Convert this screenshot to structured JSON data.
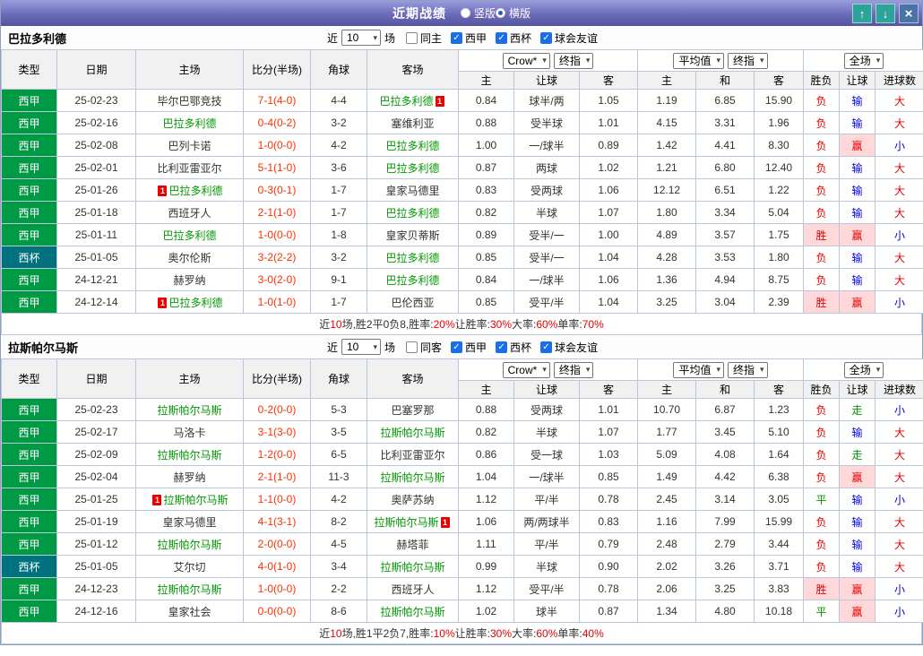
{
  "topbar": {
    "title": "近期战绩",
    "view_options": [
      {
        "label": "竖版",
        "selected": false
      },
      {
        "label": "横版",
        "selected": true
      }
    ],
    "buttons": {
      "up": "↑",
      "down": "↓",
      "close": "×"
    }
  },
  "table_header": {
    "main_cols": [
      "类型",
      "日期",
      "主场",
      "比分(半场)",
      "角球",
      "客场"
    ],
    "select_groups": [
      [
        "Crow*",
        "终指"
      ],
      [
        "平均值",
        "终指"
      ],
      [
        "全场"
      ]
    ],
    "sub_cols": [
      "主",
      "让球",
      "客",
      "主",
      "和",
      "客",
      "胜负",
      "让球",
      "进球数"
    ]
  },
  "sections": [
    {
      "team": "巴拉多利德",
      "filter": {
        "prefix": "近",
        "count": "10",
        "suffix": "场",
        "checkboxes": [
          {
            "label": "同主",
            "checked": false
          },
          {
            "label": "西甲",
            "checked": true
          },
          {
            "label": "西杯",
            "checked": true
          },
          {
            "label": "球会友谊",
            "checked": true
          }
        ]
      },
      "rows": [
        {
          "league": "西甲",
          "lg": "liga",
          "date": "25-02-23",
          "home": {
            "name": "毕尔巴鄂竞技"
          },
          "score": "7-1(4-0)",
          "corners": "4-4",
          "away": {
            "name": "巴拉多利德",
            "tracked": true,
            "red": "1",
            "red_pos": "after"
          },
          "odds": [
            "0.84",
            "球半/两",
            "1.05"
          ],
          "avg": [
            "1.19",
            "6.85",
            "15.90"
          ],
          "res": [
            {
              "t": "负",
              "c": "r"
            },
            {
              "t": "输",
              "c": "b"
            },
            {
              "t": "大",
              "c": "r"
            }
          ]
        },
        {
          "league": "西甲",
          "lg": "liga",
          "date": "25-02-16",
          "home": {
            "name": "巴拉多利德",
            "tracked": true
          },
          "score": "0-4(0-2)",
          "corners": "3-2",
          "away": {
            "name": "塞维利亚"
          },
          "odds": [
            "0.88",
            "受半球",
            "1.01"
          ],
          "avg": [
            "4.15",
            "3.31",
            "1.96"
          ],
          "res": [
            {
              "t": "负",
              "c": "r"
            },
            {
              "t": "输",
              "c": "b"
            },
            {
              "t": "大",
              "c": "r"
            }
          ]
        },
        {
          "league": "西甲",
          "lg": "liga",
          "date": "25-02-08",
          "home": {
            "name": "巴列卡诺"
          },
          "score": "1-0(0-0)",
          "corners": "4-2",
          "away": {
            "name": "巴拉多利德",
            "tracked": true
          },
          "odds": [
            "1.00",
            "一/球半",
            "0.89"
          ],
          "avg": [
            "1.42",
            "4.41",
            "8.30"
          ],
          "res": [
            {
              "t": "负",
              "c": "r"
            },
            {
              "t": "赢",
              "c": "rbg"
            },
            {
              "t": "小",
              "c": "b"
            }
          ]
        },
        {
          "league": "西甲",
          "lg": "liga",
          "date": "25-02-01",
          "home": {
            "name": "比利亚雷亚尔"
          },
          "score": "5-1(1-0)",
          "corners": "3-6",
          "away": {
            "name": "巴拉多利德",
            "tracked": true
          },
          "odds": [
            "0.87",
            "两球",
            "1.02"
          ],
          "avg": [
            "1.21",
            "6.80",
            "12.40"
          ],
          "res": [
            {
              "t": "负",
              "c": "r"
            },
            {
              "t": "输",
              "c": "b"
            },
            {
              "t": "大",
              "c": "r"
            }
          ]
        },
        {
          "league": "西甲",
          "lg": "liga",
          "date": "25-01-26",
          "home": {
            "name": "巴拉多利德",
            "tracked": true,
            "red": "1",
            "red_pos": "before"
          },
          "score": "0-3(0-1)",
          "corners": "1-7",
          "away": {
            "name": "皇家马德里"
          },
          "odds": [
            "0.83",
            "受两球",
            "1.06"
          ],
          "avg": [
            "12.12",
            "6.51",
            "1.22"
          ],
          "res": [
            {
              "t": "负",
              "c": "r"
            },
            {
              "t": "输",
              "c": "b"
            },
            {
              "t": "大",
              "c": "r"
            }
          ]
        },
        {
          "league": "西甲",
          "lg": "liga",
          "date": "25-01-18",
          "home": {
            "name": "西班牙人"
          },
          "score": "2-1(1-0)",
          "corners": "1-7",
          "away": {
            "name": "巴拉多利德",
            "tracked": true
          },
          "odds": [
            "0.82",
            "半球",
            "1.07"
          ],
          "avg": [
            "1.80",
            "3.34",
            "5.04"
          ],
          "res": [
            {
              "t": "负",
              "c": "r"
            },
            {
              "t": "输",
              "c": "b"
            },
            {
              "t": "大",
              "c": "r"
            }
          ]
        },
        {
          "league": "西甲",
          "lg": "liga",
          "date": "25-01-11",
          "home": {
            "name": "巴拉多利德",
            "tracked": true
          },
          "score": "1-0(0-0)",
          "corners": "1-8",
          "away": {
            "name": "皇家贝蒂斯"
          },
          "odds": [
            "0.89",
            "受半/一",
            "1.00"
          ],
          "avg": [
            "4.89",
            "3.57",
            "1.75"
          ],
          "res": [
            {
              "t": "胜",
              "c": "rbg"
            },
            {
              "t": "赢",
              "c": "rbg"
            },
            {
              "t": "小",
              "c": "b"
            }
          ]
        },
        {
          "league": "西杯",
          "lg": "cup",
          "date": "25-01-05",
          "home": {
            "name": "奥尔伦斯"
          },
          "score": "3-2(2-2)",
          "corners": "3-2",
          "away": {
            "name": "巴拉多利德",
            "tracked": true
          },
          "odds": [
            "0.85",
            "受半/一",
            "1.04"
          ],
          "avg": [
            "4.28",
            "3.53",
            "1.80"
          ],
          "res": [
            {
              "t": "负",
              "c": "r"
            },
            {
              "t": "输",
              "c": "b"
            },
            {
              "t": "大",
              "c": "r"
            }
          ]
        },
        {
          "league": "西甲",
          "lg": "liga",
          "date": "24-12-21",
          "home": {
            "name": "赫罗纳"
          },
          "score": "3-0(2-0)",
          "corners": "9-1",
          "away": {
            "name": "巴拉多利德",
            "tracked": true
          },
          "odds": [
            "0.84",
            "一/球半",
            "1.06"
          ],
          "avg": [
            "1.36",
            "4.94",
            "8.75"
          ],
          "res": [
            {
              "t": "负",
              "c": "r"
            },
            {
              "t": "输",
              "c": "b"
            },
            {
              "t": "大",
              "c": "r"
            }
          ]
        },
        {
          "league": "西甲",
          "lg": "liga",
          "date": "24-12-14",
          "home": {
            "name": "巴拉多利德",
            "tracked": true,
            "red": "1",
            "red_pos": "before"
          },
          "score": "1-0(1-0)",
          "corners": "1-7",
          "away": {
            "name": "巴伦西亚"
          },
          "odds": [
            "0.85",
            "受平/半",
            "1.04"
          ],
          "avg": [
            "3.25",
            "3.04",
            "2.39"
          ],
          "res": [
            {
              "t": "胜",
              "c": "rbg"
            },
            {
              "t": "赢",
              "c": "rbg"
            },
            {
              "t": "小",
              "c": "b"
            }
          ]
        }
      ],
      "summary_parts": [
        {
          "t": "近",
          "c": "k"
        },
        {
          "t": "10",
          "c": "r"
        },
        {
          "t": "场,胜2平0负8, ",
          "c": "k"
        },
        {
          "t": "胜率:",
          "c": "k"
        },
        {
          "t": "20%",
          "c": "r"
        },
        {
          "t": " 让胜率:",
          "c": "k"
        },
        {
          "t": "30%",
          "c": "r"
        },
        {
          "t": " 大率:",
          "c": "k"
        },
        {
          "t": "60%",
          "c": "r"
        },
        {
          "t": " 单率:",
          "c": "k"
        },
        {
          "t": "70%",
          "c": "r"
        }
      ]
    },
    {
      "team": "拉斯帕尔马斯",
      "filter": {
        "prefix": "近",
        "count": "10",
        "suffix": "场",
        "checkboxes": [
          {
            "label": "同客",
            "checked": false
          },
          {
            "label": "西甲",
            "checked": true
          },
          {
            "label": "西杯",
            "checked": true
          },
          {
            "label": "球会友谊",
            "checked": true
          }
        ]
      },
      "rows": [
        {
          "league": "西甲",
          "lg": "liga",
          "date": "25-02-23",
          "home": {
            "name": "拉斯帕尔马斯",
            "tracked": true
          },
          "score": "0-2(0-0)",
          "corners": "5-3",
          "away": {
            "name": "巴塞罗那"
          },
          "odds": [
            "0.88",
            "受两球",
            "1.01"
          ],
          "avg": [
            "10.70",
            "6.87",
            "1.23"
          ],
          "res": [
            {
              "t": "负",
              "c": "r"
            },
            {
              "t": "走",
              "c": "g"
            },
            {
              "t": "小",
              "c": "b"
            }
          ]
        },
        {
          "league": "西甲",
          "lg": "liga",
          "date": "25-02-17",
          "home": {
            "name": "马洛卡"
          },
          "score": "3-1(3-0)",
          "corners": "3-5",
          "away": {
            "name": "拉斯帕尔马斯",
            "tracked": true
          },
          "odds": [
            "0.82",
            "半球",
            "1.07"
          ],
          "avg": [
            "1.77",
            "3.45",
            "5.10"
          ],
          "res": [
            {
              "t": "负",
              "c": "r"
            },
            {
              "t": "输",
              "c": "b"
            },
            {
              "t": "大",
              "c": "r"
            }
          ]
        },
        {
          "league": "西甲",
          "lg": "liga",
          "date": "25-02-09",
          "home": {
            "name": "拉斯帕尔马斯",
            "tracked": true
          },
          "score": "1-2(0-0)",
          "corners": "6-5",
          "away": {
            "name": "比利亚雷亚尔"
          },
          "odds": [
            "0.86",
            "受一球",
            "1.03"
          ],
          "avg": [
            "5.09",
            "4.08",
            "1.64"
          ],
          "res": [
            {
              "t": "负",
              "c": "r"
            },
            {
              "t": "走",
              "c": "g"
            },
            {
              "t": "大",
              "c": "r"
            }
          ]
        },
        {
          "league": "西甲",
          "lg": "liga",
          "date": "25-02-04",
          "home": {
            "name": "赫罗纳"
          },
          "score": "2-1(1-0)",
          "corners": "11-3",
          "away": {
            "name": "拉斯帕尔马斯",
            "tracked": true
          },
          "odds": [
            "1.04",
            "一/球半",
            "0.85"
          ],
          "avg": [
            "1.49",
            "4.42",
            "6.38"
          ],
          "res": [
            {
              "t": "负",
              "c": "r"
            },
            {
              "t": "赢",
              "c": "rbg"
            },
            {
              "t": "大",
              "c": "r"
            }
          ]
        },
        {
          "league": "西甲",
          "lg": "liga",
          "date": "25-01-25",
          "home": {
            "name": "拉斯帕尔马斯",
            "tracked": true,
            "red": "1",
            "red_pos": "before"
          },
          "score": "1-1(0-0)",
          "corners": "4-2",
          "away": {
            "name": "奥萨苏纳"
          },
          "odds": [
            "1.12",
            "平/半",
            "0.78"
          ],
          "avg": [
            "2.45",
            "3.14",
            "3.05"
          ],
          "res": [
            {
              "t": "平",
              "c": "g"
            },
            {
              "t": "输",
              "c": "b"
            },
            {
              "t": "小",
              "c": "b"
            }
          ]
        },
        {
          "league": "西甲",
          "lg": "liga",
          "date": "25-01-19",
          "home": {
            "name": "皇家马德里"
          },
          "score": "4-1(3-1)",
          "corners": "8-2",
          "away": {
            "name": "拉斯帕尔马斯",
            "tracked": true,
            "red": "1",
            "red_pos": "after"
          },
          "odds": [
            "1.06",
            "两/两球半",
            "0.83"
          ],
          "avg": [
            "1.16",
            "7.99",
            "15.99"
          ],
          "res": [
            {
              "t": "负",
              "c": "r"
            },
            {
              "t": "输",
              "c": "b"
            },
            {
              "t": "大",
              "c": "r"
            }
          ]
        },
        {
          "league": "西甲",
          "lg": "liga",
          "date": "25-01-12",
          "home": {
            "name": "拉斯帕尔马斯",
            "tracked": true
          },
          "score": "2-0(0-0)",
          "corners": "4-5",
          "away": {
            "name": "赫塔菲"
          },
          "odds": [
            "1.11",
            "平/半",
            "0.79"
          ],
          "avg": [
            "2.48",
            "2.79",
            "3.44"
          ],
          "res": [
            {
              "t": "负",
              "c": "r"
            },
            {
              "t": "输",
              "c": "b"
            },
            {
              "t": "大",
              "c": "r"
            }
          ]
        },
        {
          "league": "西杯",
          "lg": "cup",
          "date": "25-01-05",
          "home": {
            "name": "艾尔切"
          },
          "score": "4-0(1-0)",
          "corners": "3-4",
          "away": {
            "name": "拉斯帕尔马斯",
            "tracked": true
          },
          "odds": [
            "0.99",
            "半球",
            "0.90"
          ],
          "avg": [
            "2.02",
            "3.26",
            "3.71"
          ],
          "res": [
            {
              "t": "负",
              "c": "r"
            },
            {
              "t": "输",
              "c": "b"
            },
            {
              "t": "大",
              "c": "r"
            }
          ]
        },
        {
          "league": "西甲",
          "lg": "liga",
          "date": "24-12-23",
          "home": {
            "name": "拉斯帕尔马斯",
            "tracked": true
          },
          "score": "1-0(0-0)",
          "corners": "2-2",
          "away": {
            "name": "西班牙人"
          },
          "odds": [
            "1.12",
            "受平/半",
            "0.78"
          ],
          "avg": [
            "2.06",
            "3.25",
            "3.83"
          ],
          "res": [
            {
              "t": "胜",
              "c": "rbg"
            },
            {
              "t": "赢",
              "c": "rbg"
            },
            {
              "t": "小",
              "c": "b"
            }
          ]
        },
        {
          "league": "西甲",
          "lg": "liga",
          "date": "24-12-16",
          "home": {
            "name": "皇家社会"
          },
          "score": "0-0(0-0)",
          "corners": "8-6",
          "away": {
            "name": "拉斯帕尔马斯",
            "tracked": true
          },
          "odds": [
            "1.02",
            "球半",
            "0.87"
          ],
          "avg": [
            "1.34",
            "4.80",
            "10.18"
          ],
          "res": [
            {
              "t": "平",
              "c": "g"
            },
            {
              "t": "赢",
              "c": "rbg"
            },
            {
              "t": "小",
              "c": "b"
            }
          ]
        }
      ],
      "summary_parts": [
        {
          "t": "近",
          "c": "k"
        },
        {
          "t": "10",
          "c": "r"
        },
        {
          "t": "场,胜1平2负7, ",
          "c": "k"
        },
        {
          "t": "胜率:",
          "c": "k"
        },
        {
          "t": "10%",
          "c": "r"
        },
        {
          "t": " 让胜率:",
          "c": "k"
        },
        {
          "t": "30%",
          "c": "r"
        },
        {
          "t": " 大率:",
          "c": "k"
        },
        {
          "t": "60%",
          "c": "r"
        },
        {
          "t": " 单率:",
          "c": "k"
        },
        {
          "t": "40%",
          "c": "r"
        }
      ]
    }
  ]
}
